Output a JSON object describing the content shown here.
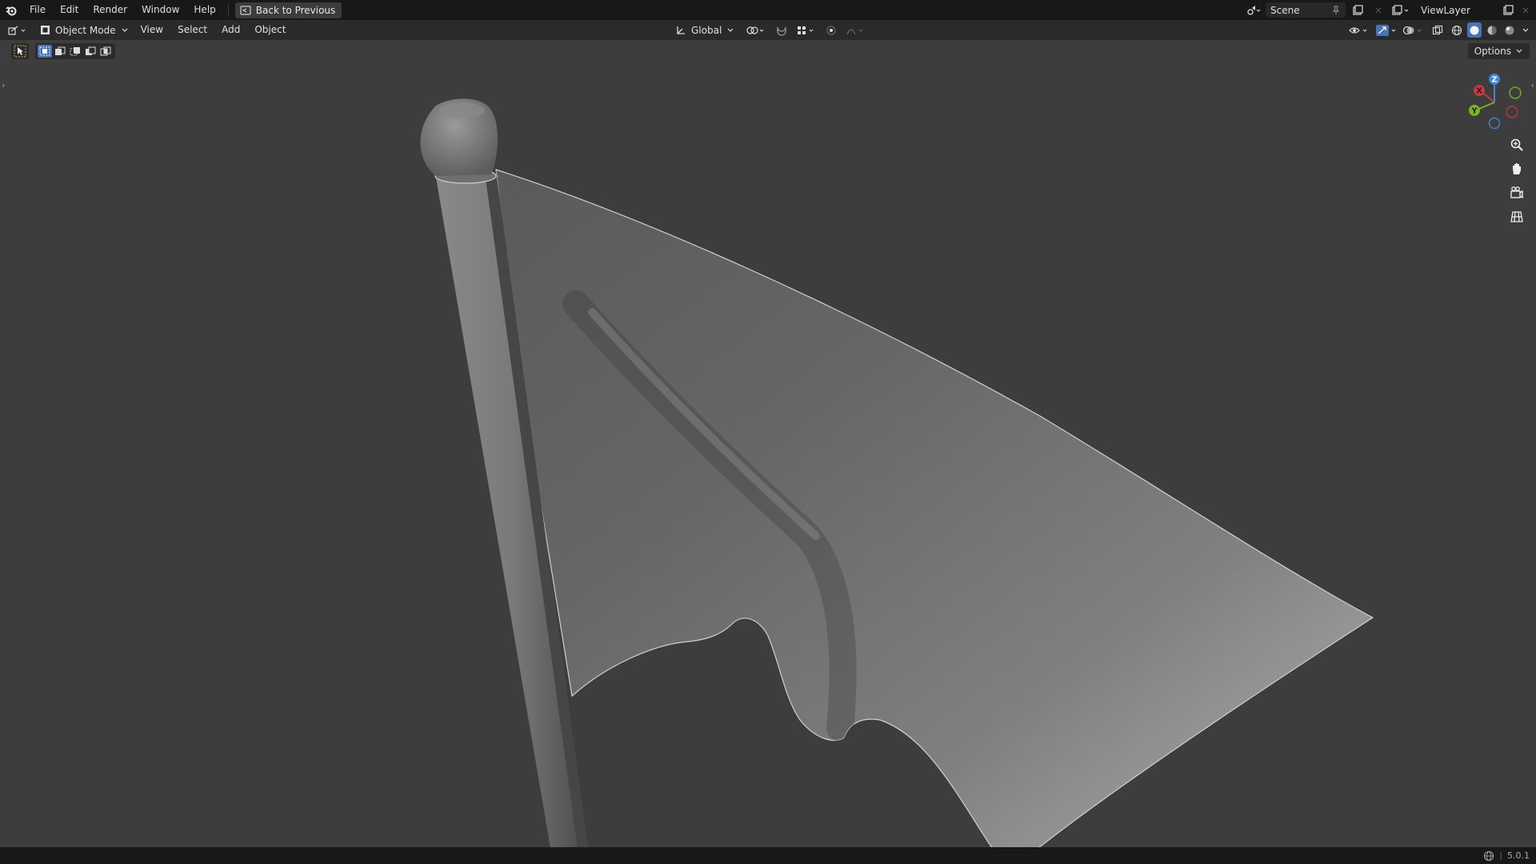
{
  "topbar": {
    "menus": [
      "File",
      "Edit",
      "Render",
      "Window",
      "Help"
    ],
    "back_label": "Back to Previous",
    "scene_label": "Scene",
    "view_layer_label": "ViewLayer"
  },
  "header": {
    "mode_label": "Object Mode",
    "menus": [
      "View",
      "Select",
      "Add",
      "Object"
    ],
    "orientation_label": "Global"
  },
  "toolbar": {
    "options_label": "Options"
  },
  "gizmo": {
    "x_label": "X",
    "y_label": "Y",
    "z_label": "Z",
    "x_color": "#c23a46",
    "y_color": "#7bb324",
    "z_color": "#3f86d4",
    "x_neg_color": "#c23a46",
    "y_neg_color": "#7bb324",
    "z_neg_color": "#3f86d4"
  },
  "statusbar": {
    "version": "5.0.1"
  },
  "colors": {
    "background": "#3d3d3d",
    "topbar": "#181818",
    "header": "#2a2a2a",
    "accent": "#4772b3",
    "tool_active_outline": "#e8a33a"
  }
}
